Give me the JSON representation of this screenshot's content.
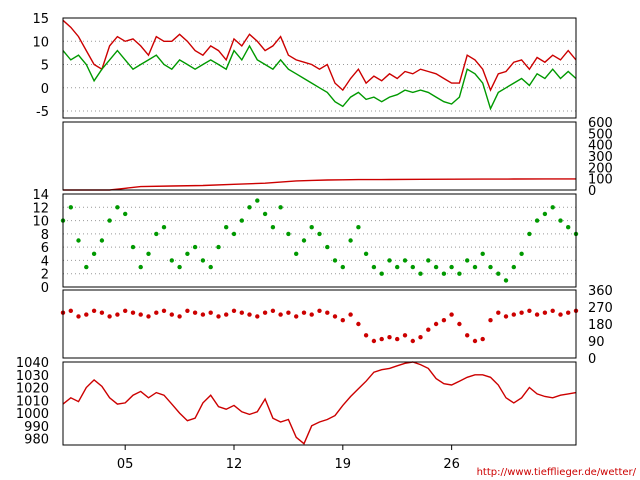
{
  "footer": {
    "url": "http://www.tiefflieger.de/wetter/"
  },
  "colors": {
    "red": "#cc0000",
    "green": "#009900",
    "grid": "#999999",
    "axis": "#000000"
  },
  "x_axis": {
    "range": [
      1,
      34
    ],
    "ticks": [
      {
        "day": 5,
        "label": "05"
      },
      {
        "day": 12,
        "label": "12"
      },
      {
        "day": 19,
        "label": "19"
      },
      {
        "day": 26,
        "label": "26"
      }
    ]
  },
  "chart_data": [
    {
      "type": "line",
      "panel": "temperature",
      "ylim": [
        -6.5,
        15
      ],
      "y_ticks": [
        15,
        10,
        5,
        0,
        -5
      ],
      "tick_side": "left",
      "grid": true,
      "series": [
        {
          "color": "red",
          "x": [
            1,
            1.5,
            2,
            2.5,
            3,
            3.5,
            4,
            4.5,
            5,
            5.5,
            6,
            6.5,
            7,
            7.5,
            8,
            8.5,
            9,
            9.5,
            10,
            10.5,
            11,
            11.5,
            12,
            12.5,
            13,
            13.5,
            14,
            14.5,
            15,
            15.5,
            16,
            16.5,
            17,
            17.5,
            18,
            18.5,
            19,
            19.5,
            20,
            20.5,
            21,
            21.5,
            22,
            22.5,
            23,
            23.5,
            24,
            24.5,
            25,
            25.5,
            26,
            26.5,
            27,
            27.5,
            28,
            28.5,
            29,
            29.5,
            30,
            30.5,
            31,
            31.5,
            32,
            32.5,
            33,
            33.5,
            34
          ],
          "y": [
            14.5,
            13,
            11,
            8,
            5,
            4,
            9,
            11,
            10,
            10.5,
            9,
            7,
            11,
            10,
            10,
            11.5,
            10,
            8,
            7,
            9,
            8,
            6,
            10.5,
            9,
            11.5,
            10,
            8,
            9,
            11,
            7,
            6,
            5.5,
            5,
            4,
            5,
            1,
            -0.5,
            2,
            4,
            1,
            2.5,
            1.5,
            3,
            2,
            3.5,
            3,
            4,
            3.5,
            3,
            2,
            1,
            1,
            7,
            6,
            4,
            -0.5,
            3,
            3.5,
            5.5,
            6,
            4,
            6.5,
            5.5,
            7,
            6,
            8,
            6
          ]
        },
        {
          "color": "green",
          "x": [
            1,
            1.5,
            2,
            2.5,
            3,
            3.5,
            4,
            4.5,
            5,
            5.5,
            6,
            6.5,
            7,
            7.5,
            8,
            8.5,
            9,
            9.5,
            10,
            10.5,
            11,
            11.5,
            12,
            12.5,
            13,
            13.5,
            14,
            14.5,
            15,
            15.5,
            16,
            16.5,
            17,
            17.5,
            18,
            18.5,
            19,
            19.5,
            20,
            20.5,
            21,
            21.5,
            22,
            22.5,
            23,
            23.5,
            24,
            24.5,
            25,
            25.5,
            26,
            26.5,
            27,
            27.5,
            28,
            28.5,
            29,
            29.5,
            30,
            30.5,
            31,
            31.5,
            32,
            32.5,
            33,
            33.5,
            34
          ],
          "y": [
            8,
            6,
            7,
            5,
            1.5,
            4,
            6,
            8,
            6,
            4,
            5,
            6,
            7,
            5,
            4,
            6,
            5,
            4,
            5,
            6,
            5,
            4,
            8,
            6,
            9,
            6,
            5,
            4,
            6,
            4,
            3,
            2,
            1,
            0,
            -1,
            -3,
            -4,
            -2,
            -1,
            -2.5,
            -2,
            -3,
            -2,
            -1.5,
            -0.5,
            -1,
            -0.5,
            -1,
            -2,
            -3,
            -3.5,
            -2,
            4,
            3,
            1,
            -4.5,
            -1,
            0,
            1,
            2,
            0.5,
            3,
            2,
            4,
            2,
            3.5,
            2
          ]
        }
      ]
    },
    {
      "type": "line",
      "panel": "rain",
      "ylim": [
        0,
        600
      ],
      "y_ticks": [
        600,
        500,
        400,
        300,
        200,
        100,
        0
      ],
      "tick_side": "right",
      "grid": false,
      "series": [
        {
          "color": "red",
          "x": [
            1,
            4,
            5,
            6,
            8,
            10,
            12,
            14,
            15,
            16,
            17,
            18,
            19,
            20,
            22,
            24,
            26,
            28,
            30,
            32,
            34
          ],
          "y": [
            0,
            0,
            15,
            30,
            35,
            40,
            50,
            60,
            70,
            80,
            85,
            88,
            90,
            92,
            93,
            94,
            95,
            96,
            97,
            98,
            98
          ]
        }
      ]
    },
    {
      "type": "scatter",
      "panel": "wind-speed",
      "ylim": [
        0,
        14
      ],
      "y_ticks": [
        14,
        12,
        10,
        8,
        6,
        4,
        2,
        0
      ],
      "tick_side": "left",
      "grid": true,
      "series": [
        {
          "color": "green",
          "x": [
            1,
            1.5,
            2,
            2.5,
            3,
            3.5,
            4,
            4.5,
            5,
            5.5,
            6,
            6.5,
            7,
            7.5,
            8,
            8.5,
            9,
            9.5,
            10,
            10.5,
            11,
            11.5,
            12,
            12.5,
            13,
            13.5,
            14,
            14.5,
            15,
            15.5,
            16,
            16.5,
            17,
            17.5,
            18,
            18.5,
            19,
            19.5,
            20,
            20.5,
            21,
            21.5,
            22,
            22.5,
            23,
            23.5,
            24,
            24.5,
            25,
            25.5,
            26,
            26.5,
            27,
            27.5,
            28,
            28.5,
            29,
            29.5,
            30,
            30.5,
            31,
            31.5,
            32,
            32.5,
            33,
            33.5,
            34
          ],
          "y": [
            10,
            12,
            7,
            3,
            5,
            7,
            10,
            12,
            11,
            6,
            3,
            5,
            8,
            9,
            4,
            3,
            5,
            6,
            4,
            3,
            6,
            9,
            8,
            10,
            12,
            13,
            11,
            9,
            12,
            8,
            5,
            7,
            9,
            8,
            6,
            4,
            3,
            7,
            9,
            5,
            3,
            2,
            4,
            3,
            4,
            3,
            2,
            4,
            3,
            2,
            3,
            2,
            4,
            3,
            5,
            3,
            2,
            1,
            3,
            5,
            8,
            10,
            11,
            12,
            10,
            9,
            8
          ]
        }
      ]
    },
    {
      "type": "scatter",
      "panel": "wind-direction",
      "ylim": [
        0,
        360
      ],
      "y_ticks": [
        360,
        270,
        180,
        90,
        0
      ],
      "tick_side": "right",
      "grid": false,
      "series": [
        {
          "color": "red",
          "x": [
            1,
            1.5,
            2,
            2.5,
            3,
            3.5,
            4,
            4.5,
            5,
            5.5,
            6,
            6.5,
            7,
            7.5,
            8,
            8.5,
            9,
            9.5,
            10,
            10.5,
            11,
            11.5,
            12,
            12.5,
            13,
            13.5,
            14,
            14.5,
            15,
            15.5,
            16,
            16.5,
            17,
            17.5,
            18,
            18.5,
            19,
            19.5,
            20,
            20.5,
            21,
            21.5,
            22,
            22.5,
            23,
            23.5,
            24,
            24.5,
            25,
            25.5,
            26,
            26.5,
            27,
            27.5,
            28,
            28.5,
            29,
            29.5,
            30,
            30.5,
            31,
            31.5,
            32,
            32.5,
            33,
            33.5,
            34
          ],
          "y": [
            240,
            250,
            220,
            230,
            250,
            240,
            220,
            230,
            250,
            240,
            230,
            220,
            240,
            250,
            230,
            220,
            250,
            240,
            230,
            240,
            220,
            230,
            250,
            240,
            230,
            220,
            240,
            250,
            230,
            240,
            220,
            240,
            230,
            250,
            240,
            220,
            200,
            230,
            180,
            120,
            90,
            100,
            110,
            100,
            120,
            90,
            110,
            150,
            180,
            200,
            230,
            180,
            120,
            90,
            100,
            200,
            240,
            220,
            230,
            240,
            250,
            230,
            240,
            250,
            230,
            240,
            250
          ]
        }
      ]
    },
    {
      "type": "line",
      "panel": "pressure",
      "ylim": [
        975,
        1040
      ],
      "y_ticks": [
        1040,
        1030,
        1020,
        1010,
        1000,
        990,
        980
      ],
      "tick_side": "left",
      "grid": false,
      "series": [
        {
          "color": "red",
          "x": [
            1,
            1.5,
            2,
            2.5,
            3,
            3.5,
            4,
            4.5,
            5,
            5.5,
            6,
            6.5,
            7,
            7.5,
            8,
            8.5,
            9,
            9.5,
            10,
            10.5,
            11,
            11.5,
            12,
            12.5,
            13,
            13.5,
            14,
            14.5,
            15,
            15.5,
            16,
            16.5,
            17,
            17.5,
            18,
            18.5,
            19,
            19.5,
            20,
            20.5,
            21,
            21.5,
            22,
            22.5,
            23,
            23.5,
            24,
            24.5,
            25,
            25.5,
            26,
            26.5,
            27,
            27.5,
            28,
            28.5,
            29,
            29.5,
            30,
            30.5,
            31,
            31.5,
            32,
            32.5,
            33,
            33.5,
            34
          ],
          "y": [
            1007,
            1012,
            1009,
            1020,
            1026,
            1021,
            1012,
            1007,
            1008,
            1014,
            1017,
            1012,
            1016,
            1014,
            1007,
            1000,
            994,
            996,
            1008,
            1014,
            1005,
            1003,
            1006,
            1001,
            999,
            1001,
            1011,
            996,
            993,
            995,
            981,
            976,
            990,
            993,
            995,
            998,
            1006,
            1013,
            1019,
            1025,
            1032,
            1034,
            1035,
            1037,
            1039,
            1040,
            1038,
            1035,
            1027,
            1023,
            1022,
            1025,
            1028,
            1030,
            1030,
            1028,
            1022,
            1012,
            1008,
            1012,
            1020,
            1015,
            1013,
            1012,
            1014,
            1015,
            1016
          ]
        }
      ]
    }
  ]
}
